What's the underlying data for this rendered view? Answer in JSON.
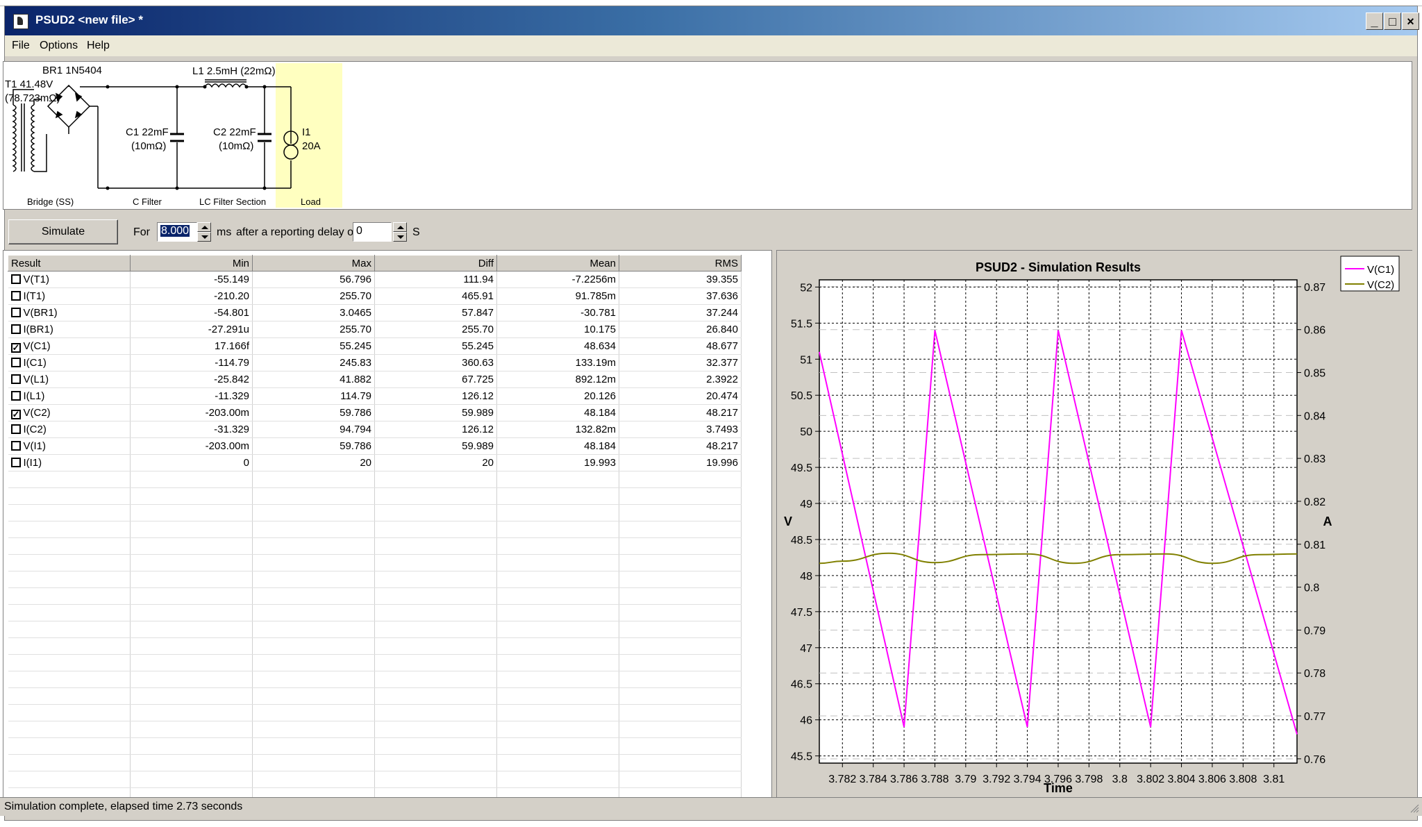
{
  "window": {
    "title": "PSUD2  <new file> *",
    "controls": {
      "minimize": "_",
      "maximize": "□",
      "close": "×"
    }
  },
  "menu": {
    "file": "File",
    "options": "Options",
    "help": "Help"
  },
  "schematic": {
    "bridge_label": "BR1 1N5404",
    "transformer_label": "T1 41.48V",
    "transformer_res": "(78.723mΩ)",
    "inductor_label": "L1 2.5mH (22mΩ)",
    "c1_label": "C1 22mF",
    "c1_res": "(10mΩ)",
    "c2_label": "C2 22mF",
    "c2_res": "(10mΩ)",
    "load_label": "I1",
    "load_value": "20A",
    "section_bridge": "Bridge (SS)",
    "section_cfilter": "C Filter",
    "section_lcfilter": "LC Filter Section",
    "section_load": "Load"
  },
  "controls": {
    "simulate_button": "Simulate",
    "for_label": "For",
    "duration_value": "8.000",
    "duration_unit": "ms",
    "delay_label": "after a reporting delay of",
    "delay_value": "0",
    "delay_unit": "S"
  },
  "results": {
    "columns": [
      "Result",
      "Min",
      "Max",
      "Diff",
      "Mean",
      "RMS"
    ],
    "rows": [
      {
        "name": "V(T1)",
        "checked": false,
        "min": "-55.149",
        "max": "56.796",
        "diff": "111.94",
        "mean": "-7.2256m",
        "rms": "39.355"
      },
      {
        "name": "I(T1)",
        "checked": false,
        "min": "-210.20",
        "max": "255.70",
        "diff": "465.91",
        "mean": "91.785m",
        "rms": "37.636"
      },
      {
        "name": "V(BR1)",
        "checked": false,
        "min": "-54.801",
        "max": "3.0465",
        "diff": "57.847",
        "mean": "-30.781",
        "rms": "37.244"
      },
      {
        "name": "I(BR1)",
        "checked": false,
        "min": "-27.291u",
        "max": "255.70",
        "diff": "255.70",
        "mean": "10.175",
        "rms": "26.840"
      },
      {
        "name": "V(C1)",
        "checked": true,
        "min": "17.166f",
        "max": "55.245",
        "diff": "55.245",
        "mean": "48.634",
        "rms": "48.677"
      },
      {
        "name": "I(C1)",
        "checked": false,
        "min": "-114.79",
        "max": "245.83",
        "diff": "360.63",
        "mean": "133.19m",
        "rms": "32.377"
      },
      {
        "name": "V(L1)",
        "checked": false,
        "min": "-25.842",
        "max": "41.882",
        "diff": "67.725",
        "mean": "892.12m",
        "rms": "2.3922"
      },
      {
        "name": "I(L1)",
        "checked": false,
        "min": "-11.329",
        "max": "114.79",
        "diff": "126.12",
        "mean": "20.126",
        "rms": "20.474"
      },
      {
        "name": "V(C2)",
        "checked": true,
        "min": "-203.00m",
        "max": "59.786",
        "diff": "59.989",
        "mean": "48.184",
        "rms": "48.217"
      },
      {
        "name": "I(C2)",
        "checked": false,
        "min": "-31.329",
        "max": "94.794",
        "diff": "126.12",
        "mean": "132.82m",
        "rms": "3.7493"
      },
      {
        "name": "V(I1)",
        "checked": false,
        "min": "-203.00m",
        "max": "59.786",
        "diff": "59.989",
        "mean": "48.184",
        "rms": "48.217"
      },
      {
        "name": "I(I1)",
        "checked": false,
        "min": "0",
        "max": "20",
        "diff": "20",
        "mean": "19.993",
        "rms": "19.996"
      }
    ]
  },
  "chart_data": {
    "type": "line",
    "title": "PSUD2 - Simulation Results",
    "xlabel": "Time",
    "ylabel": "V",
    "ylabel_right": "A",
    "xlim": [
      3.7805,
      3.8115
    ],
    "ylim": [
      45.4,
      52.1
    ],
    "ylim_right": [
      0.759,
      0.8716
    ],
    "xticks": [
      "3.782",
      "3.784",
      "3.786",
      "3.788",
      "3.79",
      "3.792",
      "3.794",
      "3.796",
      "3.798",
      "3.8",
      "3.802",
      "3.804",
      "3.806",
      "3.808",
      "3.81"
    ],
    "yticks": [
      "52",
      "51.5",
      "51",
      "50.5",
      "50",
      "49.5",
      "49",
      "48.5",
      "48",
      "47.5",
      "47",
      "46.5",
      "46",
      "45.5"
    ],
    "yticks_right": [
      "0.87",
      "0.86",
      "0.85",
      "0.84",
      "0.83",
      "0.82",
      "0.81",
      "0.8",
      "0.79",
      "0.78",
      "0.77",
      "0.76"
    ],
    "grid": true,
    "legend_position": "outside-right-top",
    "series": [
      {
        "name": "V(C1)",
        "color": "#ff00ff",
        "x": [
          3.7805,
          3.786,
          3.788,
          3.794,
          3.796,
          3.802,
          3.804,
          3.8115
        ],
        "y": [
          51.1,
          45.9,
          51.4,
          45.9,
          51.4,
          45.9,
          51.4,
          45.8
        ]
      },
      {
        "name": "V(C2)",
        "color": "#808000",
        "x": [
          3.7805,
          3.782,
          3.785,
          3.788,
          3.791,
          3.794,
          3.797,
          3.8,
          3.803,
          3.806,
          3.809,
          3.8115
        ],
        "y": [
          48.17,
          48.2,
          48.31,
          48.18,
          48.29,
          48.3,
          48.17,
          48.29,
          48.3,
          48.17,
          48.29,
          48.3
        ]
      }
    ]
  },
  "status": {
    "text": "Simulation complete, elapsed time 2.73 seconds"
  }
}
